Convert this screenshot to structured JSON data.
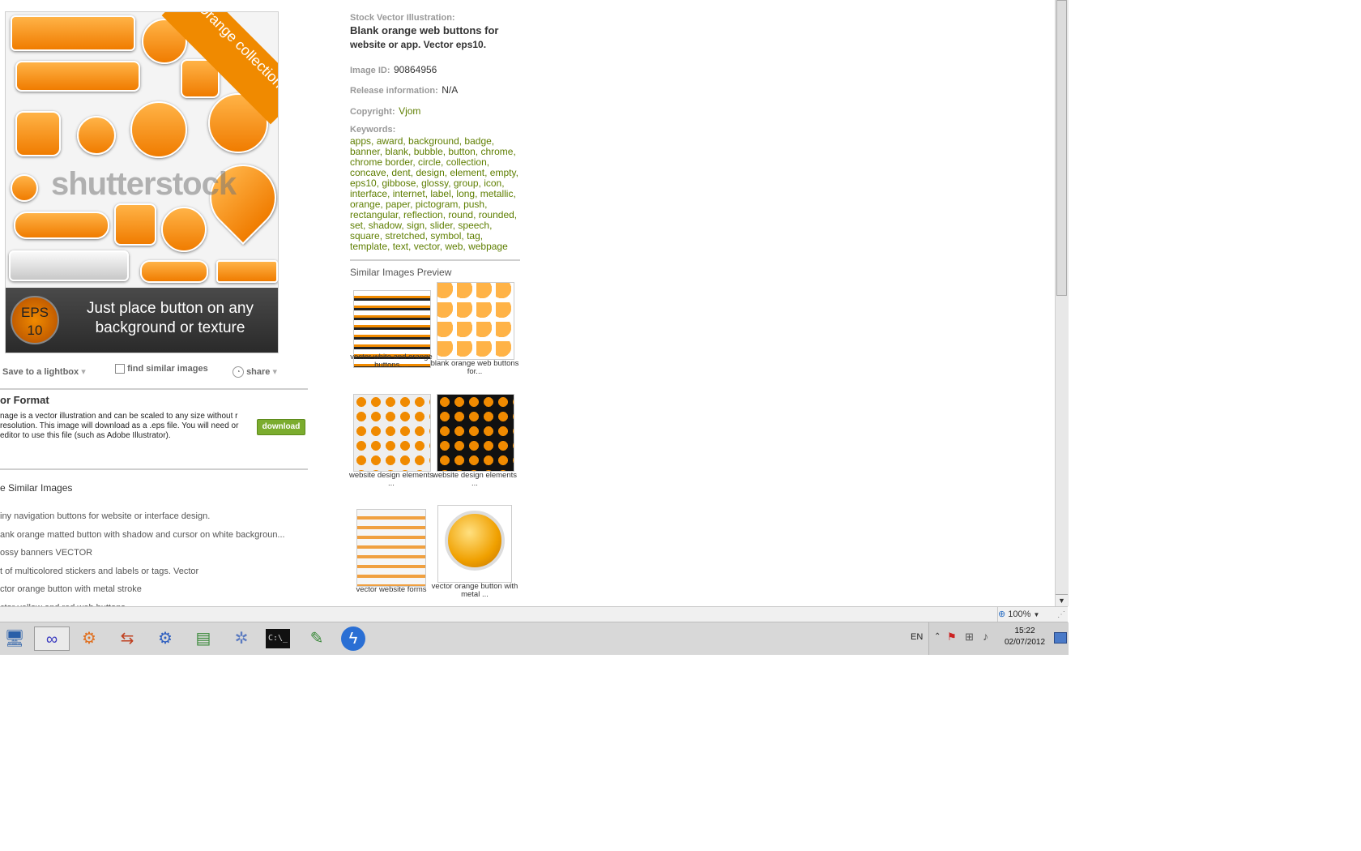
{
  "preview": {
    "ribbon_text": "Orange collection",
    "watermark": "shutterstock",
    "eps_badge_top": "EPS",
    "eps_badge_bottom": "10",
    "eps_text": "Just place button on any background or texture"
  },
  "actions": {
    "save": "Save to a lightbox",
    "find_similar": "find similar images",
    "share": "share"
  },
  "format": {
    "heading": "or Format",
    "body": "nage is a vector illustration and can be scaled to any size without r resolution. This image will download as a .eps file. You will need or editor to use this file (such as Adobe Illustrator).",
    "download": "download"
  },
  "similar_list": {
    "heading": "e Similar Images",
    "items": [
      "iny navigation buttons for website or interface design.",
      "ank orange matted button with shadow and cursor on white backgroun...",
      "ossy banners VECTOR",
      "t of multicolored stickers and labels or tags. Vector",
      "ctor orange button with metal stroke",
      "ctor yellow and red web buttons"
    ]
  },
  "details": {
    "type_label": "Stock Vector Illustration:",
    "title_line1": "Blank orange web buttons for",
    "title_line2": "website or app. Vector eps10.",
    "image_id_label": "Image ID:",
    "image_id": "90864956",
    "release_label": "Release  information:",
    "release": "N/A",
    "copyright_label": "Copyright:",
    "copyright": "Vjom",
    "keywords_label": "Keywords:",
    "keywords": "apps, award, background, badge, banner, blank, bubble, button, chrome, chrome border, circle, collection, concave, dent, design, element, empty, eps10, gibbose, glossy, group, icon, interface, internet, label, long, metallic, orange, paper, pictogram, push, rectangular, reflection, round, rounded, set, shadow, sign, slider, speech, square, stretched, symbol, tag, template, text, vector, web, webpage"
  },
  "similar_preview": {
    "heading": "Similar Images Preview",
    "items": [
      {
        "caption": "vector white and orange buttons ..."
      },
      {
        "caption": "blank orange web buttons for..."
      },
      {
        "caption": "website design elements ..."
      },
      {
        "caption": "website design elements ..."
      },
      {
        "caption": "vector website forms"
      },
      {
        "caption": "vector orange button with metal ..."
      }
    ]
  },
  "statusbar": {
    "zoom": "100%"
  },
  "taskbar": {
    "language": "EN",
    "time": "15:22",
    "date": "02/07/2012"
  },
  "colors": {
    "accent": "#f08a00",
    "link": "#5e7e00",
    "download_btn": "#7bac2e"
  }
}
